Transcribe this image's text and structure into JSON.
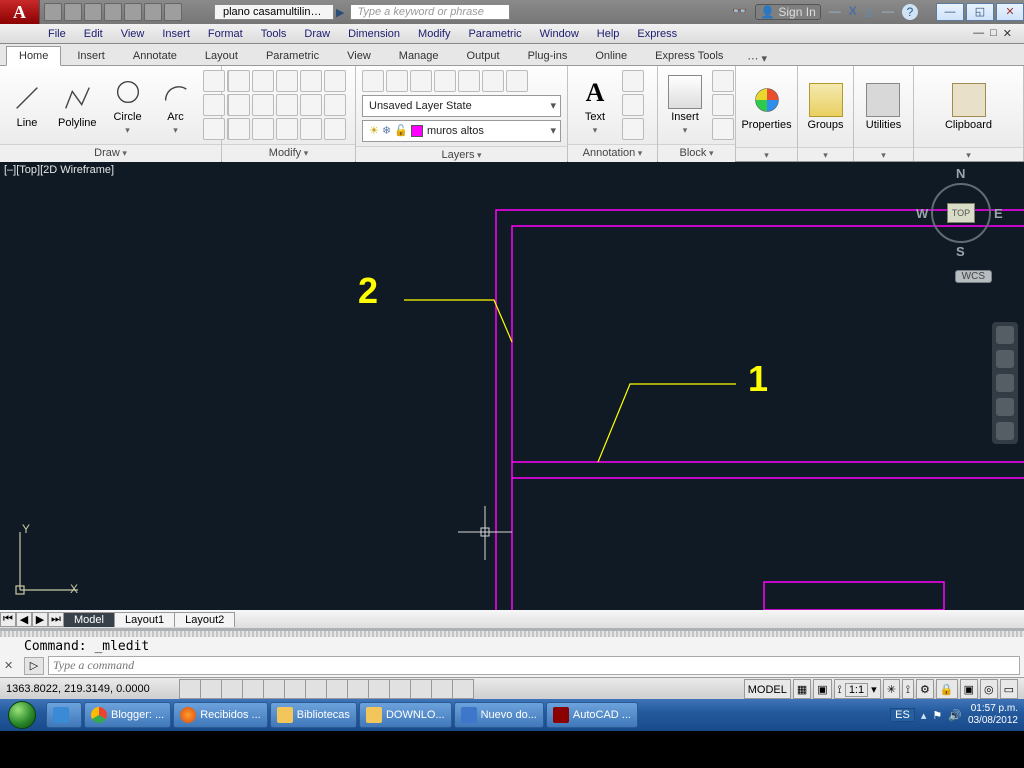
{
  "qat": {
    "doc_title": "plano casamultiline.d...",
    "search_placeholder": "Type a keyword or phrase",
    "signin": "Sign In"
  },
  "menubar": [
    "File",
    "Edit",
    "View",
    "Insert",
    "Format",
    "Tools",
    "Draw",
    "Dimension",
    "Modify",
    "Parametric",
    "Window",
    "Help",
    "Express"
  ],
  "ribbon_tabs": [
    "Home",
    "Insert",
    "Annotate",
    "Layout",
    "Parametric",
    "View",
    "Manage",
    "Output",
    "Plug-ins",
    "Online",
    "Express Tools"
  ],
  "ribbon_active": "Home",
  "panel": {
    "draw": {
      "title": "Draw",
      "line": "Line",
      "polyline": "Polyline",
      "circle": "Circle",
      "arc": "Arc"
    },
    "modify": {
      "title": "Modify"
    },
    "layers": {
      "title": "Layers",
      "layer_state": "Unsaved Layer State",
      "current_layer": "muros altos",
      "layer_color": "#ff00ff"
    },
    "annotation": {
      "title": "Annotation",
      "text": "Text"
    },
    "block": {
      "title": "Block",
      "insert": "Insert"
    },
    "properties": {
      "title": "Properties"
    },
    "groups": {
      "title": "Groups"
    },
    "utilities": {
      "title": "Utilities"
    },
    "clipboard": {
      "title": "Clipboard"
    }
  },
  "view": {
    "label": "[–][Top][2D Wireframe]",
    "callout1": "1",
    "callout2": "2",
    "compass": {
      "n": "N",
      "e": "E",
      "s": "S",
      "w": "W",
      "top": "TOP"
    },
    "wcs": "WCS",
    "axis_y": "Y",
    "axis_x": "X"
  },
  "sheets": {
    "active": "Model",
    "others": [
      "Layout1",
      "Layout2"
    ]
  },
  "command": {
    "history": "Command: _mledit",
    "placeholder": "Type a command"
  },
  "status": {
    "coords": "1363.8022, 219.3149, 0.0000",
    "model": "MODEL",
    "scale": "1:1"
  },
  "taskbar": {
    "items": [
      "Blogger: ...",
      "Recibidos ...",
      "Bibliotecas",
      "DOWNLO...",
      "Nuevo do...",
      "AutoCAD ..."
    ],
    "lang": "ES",
    "time": "01:57 p.m.",
    "date": "03/08/2012"
  }
}
